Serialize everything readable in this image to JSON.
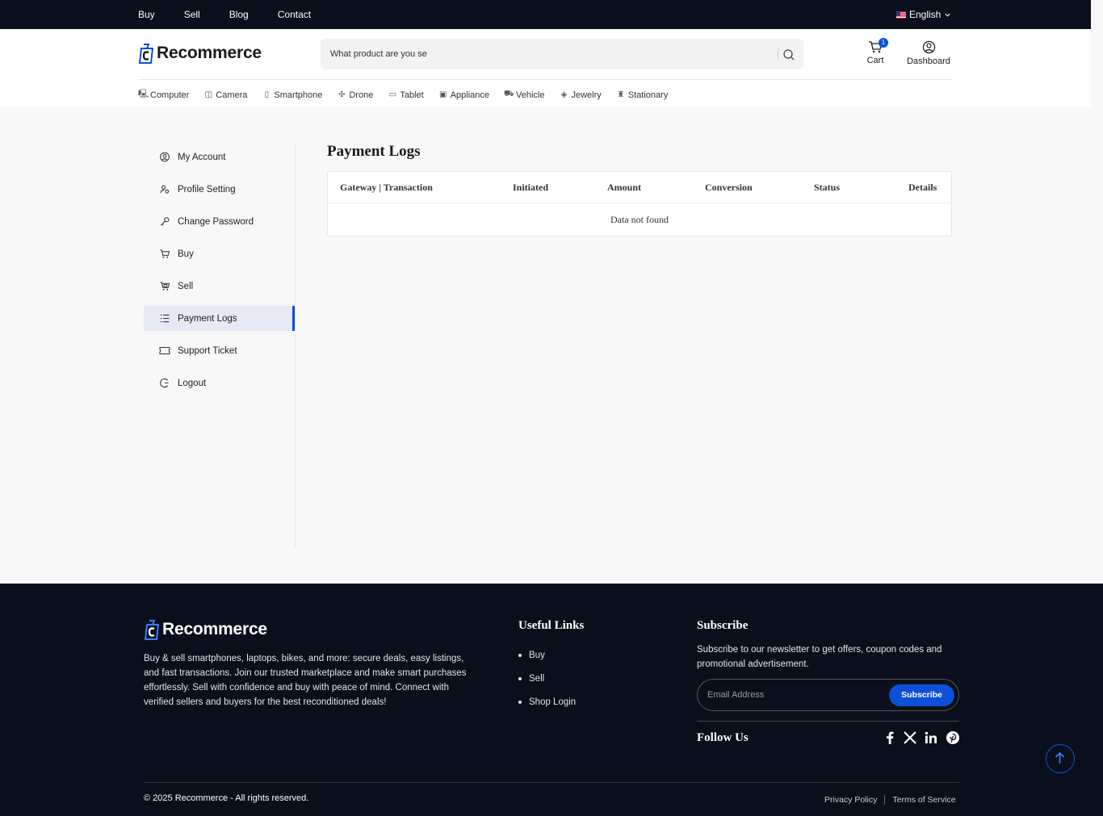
{
  "topbar": {
    "nav": [
      "Buy",
      "Sell",
      "Blog",
      "Contact"
    ],
    "language": "English"
  },
  "header": {
    "brand": "Recommerce",
    "search_placeholder": "What product are you se",
    "cart_label": "Cart",
    "cart_count": "1",
    "dashboard_label": "Dashboard"
  },
  "categories": [
    {
      "label": "Computer",
      "icon": "computer-icon"
    },
    {
      "label": "Camera",
      "icon": "camera-icon"
    },
    {
      "label": "Smartphone",
      "icon": "smartphone-icon"
    },
    {
      "label": "Drone",
      "icon": "drone-icon"
    },
    {
      "label": "Tablet",
      "icon": "tablet-icon"
    },
    {
      "label": "Appliance",
      "icon": "appliance-icon"
    },
    {
      "label": "Vehicle",
      "icon": "vehicle-icon"
    },
    {
      "label": "Jewelry",
      "icon": "jewelry-icon"
    },
    {
      "label": "Stationary",
      "icon": "stationary-icon"
    }
  ],
  "sidebar": {
    "items": [
      {
        "label": "My Account",
        "icon": "user-circle-icon"
      },
      {
        "label": "Profile Setting",
        "icon": "user-gear-icon"
      },
      {
        "label": "Change Password",
        "icon": "key-icon"
      },
      {
        "label": "Buy",
        "icon": "cart-icon"
      },
      {
        "label": "Sell",
        "icon": "sell-cart-icon"
      },
      {
        "label": "Payment Logs",
        "icon": "list-icon",
        "active": true
      },
      {
        "label": "Support Ticket",
        "icon": "ticket-icon"
      },
      {
        "label": "Logout",
        "icon": "logout-icon"
      }
    ]
  },
  "main": {
    "title": "Payment Logs",
    "table": {
      "columns": [
        "Gateway | Transaction",
        "Initiated",
        "Amount",
        "Conversion",
        "Status",
        "Details"
      ],
      "empty_message": "Data not found"
    }
  },
  "footer": {
    "brand": "Recommerce",
    "about": "Buy & sell smartphones, laptops, bikes, and more: secure deals, easy listings, and fast transactions. Join our trusted marketplace and make smart purchases effortlessly. Sell with confidence and buy with peace of mind. Connect with verified sellers and buyers for the best reconditioned deals!",
    "useful_links_title": "Useful Links",
    "useful_links": [
      "Buy",
      "Sell",
      "Shop Login"
    ],
    "subscribe_title": "Subscribe",
    "subscribe_text": "Subscribe to our newsletter to get offers, coupon codes and promotional advertisement.",
    "email_placeholder": "Email Address",
    "subscribe_button": "Subscribe",
    "follow_title": "Follow Us",
    "social": [
      "facebook-icon",
      "x-icon",
      "linkedin-icon",
      "pinterest-icon"
    ],
    "copyright": "© 2025 Recommerce - All rights reserved.",
    "privacy": "Privacy Policy",
    "terms": "Terms of Service"
  },
  "colors": {
    "accent": "#0b50d6",
    "dark": "#0a0f1c"
  }
}
